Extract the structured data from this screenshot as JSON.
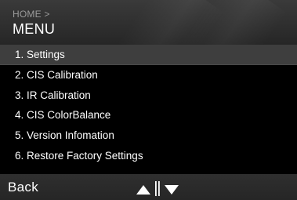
{
  "header": {
    "breadcrumb": "HOME >",
    "title": "MENU"
  },
  "menu": {
    "items": [
      {
        "label": "1. Settings",
        "selected": true
      },
      {
        "label": "2. CIS Calibration",
        "selected": false
      },
      {
        "label": "3. IR Calibration",
        "selected": false
      },
      {
        "label": "4. CIS ColorBalance",
        "selected": false
      },
      {
        "label": "5. Version Infomation",
        "selected": false
      },
      {
        "label": "6. Restore Factory Settings",
        "selected": false
      }
    ]
  },
  "footer": {
    "back_label": "Back",
    "up_icon": "triangle-up-icon",
    "down_icon": "triangle-down-icon"
  },
  "colors": {
    "background": "#000000",
    "selected_row": "#3e3e3e",
    "header_bar": "#333333",
    "text": "#ffffff",
    "breadcrumb_text": "#9a9a9a"
  }
}
